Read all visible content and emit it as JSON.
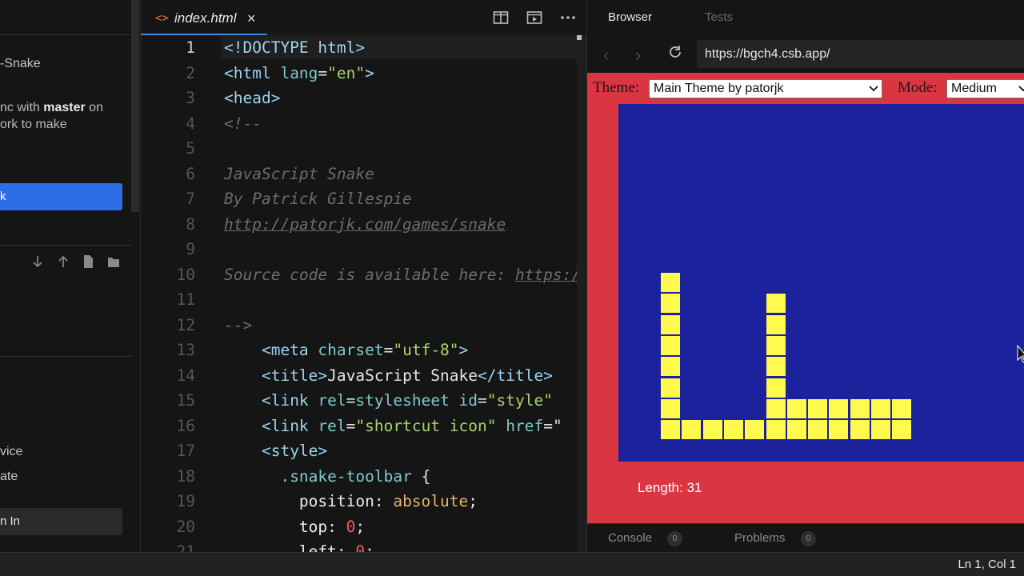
{
  "sidebar": {
    "snake_label": "-Snake",
    "sync_prefix": "nc with ",
    "sync_branch": "master",
    "sync_suffix": " on",
    "sync_line2": "ork to make",
    "primary_button": "k",
    "icons": [
      "arrow-down-icon",
      "arrow-up-icon",
      "new-file-icon",
      "new-folder-icon"
    ],
    "item_device": "vice",
    "item_template": "ate",
    "signin_button": "n In"
  },
  "editor": {
    "tab": {
      "label": "index.html",
      "icon": "<>",
      "close": "×"
    },
    "toolbar": [
      "split-editor-icon",
      "preview-icon",
      "more-icon"
    ],
    "active_line": 1,
    "lines": [
      [
        [
          "t-tag",
          "<!DOCTYPE html>"
        ]
      ],
      [
        [
          "t-tag",
          "<html "
        ],
        [
          "t-attr",
          "lang"
        ],
        [
          "t-punc",
          "="
        ],
        [
          "t-str",
          "\"en\""
        ],
        [
          "t-tag",
          ">"
        ]
      ],
      [
        [
          "t-tag",
          "<head>"
        ]
      ],
      [
        [
          "t-cmt",
          "<!--"
        ]
      ],
      [],
      [
        [
          "t-cmt",
          "JavaScript Snake"
        ]
      ],
      [
        [
          "t-cmt",
          "By Patrick Gillespie"
        ]
      ],
      [
        [
          "t-lnk",
          "http://patorjk.com/games/snake"
        ]
      ],
      [],
      [
        [
          "t-cmt",
          "Source code is available here: "
        ],
        [
          "t-lnk",
          "https://github.com/patorjk/JavaScript-Snake"
        ]
      ],
      [],
      [
        [
          "t-cmt",
          "-->"
        ]
      ],
      [
        [
          "t-punc",
          "    "
        ],
        [
          "t-tag",
          "<meta "
        ],
        [
          "t-attr",
          "charset"
        ],
        [
          "t-punc",
          "="
        ],
        [
          "t-str",
          "\"utf-8\""
        ],
        [
          "t-tag",
          ">"
        ]
      ],
      [
        [
          "t-punc",
          "    "
        ],
        [
          "t-tag",
          "<title>"
        ],
        [
          "t-punc",
          "JavaScript Snake"
        ],
        [
          "t-tag",
          "</title>"
        ]
      ],
      [
        [
          "t-punc",
          "    "
        ],
        [
          "t-tag",
          "<link "
        ],
        [
          "t-attr",
          "rel"
        ],
        [
          "t-punc",
          "="
        ],
        [
          "t-attr",
          "stylesheet "
        ],
        [
          "t-attr",
          "id"
        ],
        [
          "t-punc",
          "="
        ],
        [
          "t-str",
          "\"style\" "
        ]
      ],
      [
        [
          "t-punc",
          "    "
        ],
        [
          "t-tag",
          "<link "
        ],
        [
          "t-attr",
          "rel"
        ],
        [
          "t-punc",
          "="
        ],
        [
          "t-str",
          "\"shortcut icon\" "
        ],
        [
          "t-attr",
          "href"
        ],
        [
          "t-punc",
          "=\""
        ]
      ],
      [
        [
          "t-punc",
          "    "
        ],
        [
          "t-tag",
          "<style>"
        ]
      ],
      [
        [
          "t-punc",
          "      "
        ],
        [
          "t-attr",
          ".snake-toolbar"
        ],
        [
          "t-punc",
          " {"
        ]
      ],
      [
        [
          "t-punc",
          "        "
        ],
        [
          "t-prop",
          "position"
        ],
        [
          "t-punc",
          ": "
        ],
        [
          "t-val",
          "absolute"
        ],
        [
          "t-punc",
          ";"
        ]
      ],
      [
        [
          "t-punc",
          "        "
        ],
        [
          "t-prop",
          "top"
        ],
        [
          "t-punc",
          ": "
        ],
        [
          "t-num",
          "0"
        ],
        [
          "t-punc",
          ";"
        ]
      ],
      [
        [
          "t-punc",
          "        "
        ],
        [
          "t-prop",
          "left"
        ],
        [
          "t-punc",
          ": "
        ],
        [
          "t-num",
          "0"
        ],
        [
          "t-punc",
          ";"
        ]
      ]
    ]
  },
  "browser": {
    "tabs": [
      "Browser",
      "Tests"
    ],
    "url": "https://bgch4.csb.app/",
    "theme_label": "Theme:",
    "theme_value": "Main Theme by patorjk",
    "mode_label": "Mode:",
    "mode_value": "Medium",
    "length_text": "Length: 31",
    "snake_cells": [
      [
        2,
        8
      ],
      [
        2,
        9
      ],
      [
        2,
        10
      ],
      [
        2,
        11
      ],
      [
        2,
        12
      ],
      [
        2,
        13
      ],
      [
        2,
        14
      ],
      [
        2,
        15
      ],
      [
        3,
        15
      ],
      [
        4,
        15
      ],
      [
        5,
        15
      ],
      [
        6,
        15
      ],
      [
        7,
        15
      ],
      [
        7,
        14
      ],
      [
        7,
        13
      ],
      [
        7,
        12
      ],
      [
        7,
        11
      ],
      [
        7,
        10
      ],
      [
        7,
        9
      ],
      [
        8,
        14
      ],
      [
        9,
        14
      ],
      [
        10,
        14
      ],
      [
        11,
        14
      ],
      [
        12,
        14
      ],
      [
        13,
        14
      ],
      [
        8,
        15
      ],
      [
        9,
        15
      ],
      [
        10,
        15
      ],
      [
        11,
        15
      ],
      [
        12,
        15
      ],
      [
        13,
        15
      ]
    ]
  },
  "bottom_tabs": [
    {
      "label": "Console",
      "count": "0"
    },
    {
      "label": "Problems",
      "count": "0"
    }
  ],
  "status": {
    "position": "Ln 1, Col 1"
  }
}
